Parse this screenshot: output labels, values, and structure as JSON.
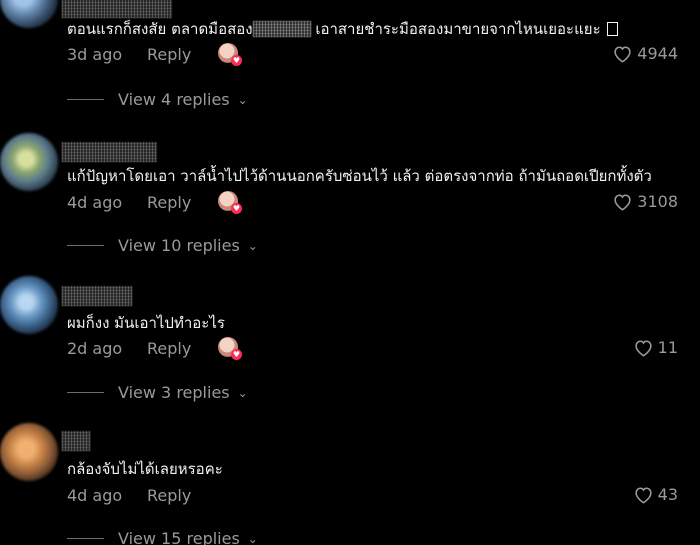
{
  "comments": [
    {
      "text_a": "ตอนแรกก็สงสัย ตลาดมือสอง",
      "text_b": " เอาสายชำระมือสองมาขายจากไหนเยอะแยะ",
      "time": "3d ago",
      "reply_label": "Reply",
      "likes": "4944",
      "view_replies": "View 4 replies"
    },
    {
      "text": "แก้ปัญหาโดยเอา วาล์น้ำไปไว้ด้านนอกครับซ่อนไว้ แล้ว ต่อตรงจากท่อ ถ้ามันถอดเปียกทั้งตัว",
      "time": "4d ago",
      "reply_label": "Reply",
      "likes": "3108",
      "view_replies": "View 10 replies"
    },
    {
      "text": "ผมก็งง มันเอาไปทำอะไร",
      "time": "2d ago",
      "reply_label": "Reply",
      "likes": "11",
      "view_replies": "View 3 replies"
    },
    {
      "text": "กล้องจับไม่ได้เลยหรอคะ",
      "time": "4d ago",
      "reply_label": "Reply",
      "likes": "43",
      "view_replies": "View 15 replies"
    }
  ],
  "icons": {
    "like": "heart-outline-icon",
    "creator_like": "creator-avatar-heart-icon",
    "expand": "chevron-down-icon"
  },
  "colors": {
    "background": "#000000",
    "text": "#f2f2f2",
    "muted": "#9a9a9a",
    "accent": "#fe2c55"
  }
}
